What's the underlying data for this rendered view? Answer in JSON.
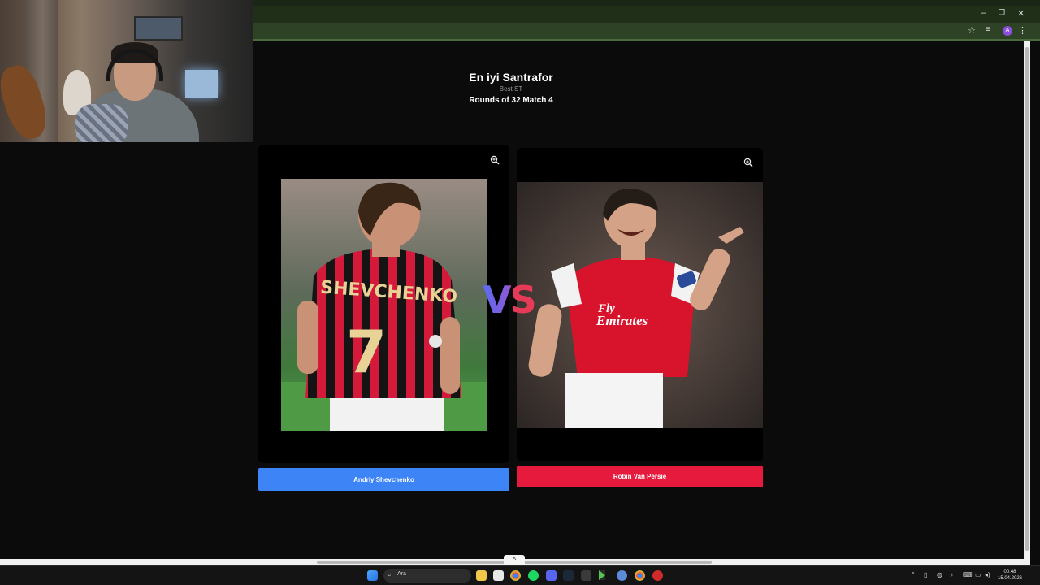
{
  "page": {
    "title": "En iyi Santrafor",
    "subtitle": "Best ST",
    "round": "Rounds of 32 Match 4",
    "vs_text": "VS"
  },
  "candidates": [
    {
      "name": "Andriy Shevchenko",
      "button_color": "#3d84f6"
    },
    {
      "name": "Robin Van Persie",
      "button_color": "#e61a3c"
    }
  ],
  "browser": {
    "icons": [
      "minimize-icon",
      "restore-icon",
      "close-icon",
      "star-icon",
      "media-icon",
      "profile-icon",
      "menu-icon"
    ],
    "profile_initial": "A"
  },
  "taskbar": {
    "search_placeholder": "Ara",
    "time": "00:48",
    "date": "15.04.2026"
  }
}
